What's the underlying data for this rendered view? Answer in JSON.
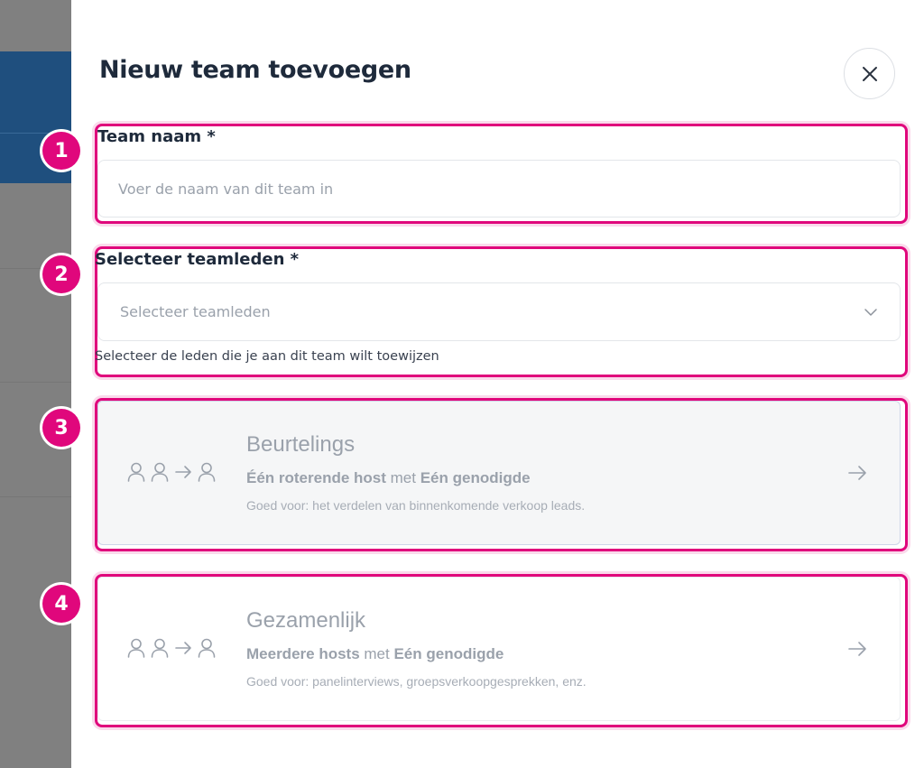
{
  "panel": {
    "title": "Nieuw team toevoegen"
  },
  "badges": [
    "1",
    "2",
    "3",
    "4"
  ],
  "team_name": {
    "label": "Team naam *",
    "placeholder": "Voer de naam van dit team in",
    "value": ""
  },
  "members": {
    "label": "Selecteer teamleden *",
    "placeholder": "Selecteer teamleden",
    "helper": "Selecteer de leden die je aan dit team wilt toewijzen"
  },
  "options": [
    {
      "title": "Beurtelings",
      "sub_bold_1": "Één roterende host",
      "sub_mid": " met ",
      "sub_bold_2": "Eén genodigde",
      "description": "Goed voor: het verdelen van binnenkomende verkoop leads."
    },
    {
      "title": "Gezamenlijk",
      "sub_bold_1": "Meerdere hosts",
      "sub_mid": " met ",
      "sub_bold_2": "Eén genodigde",
      "description": "Goed voor: panelinterviews, groepsverkoopgesprekken, enz."
    }
  ],
  "icons": {
    "close": "close-icon",
    "chevron": "chevron-down-icon",
    "user": "user-icon",
    "arrow": "arrow-right-icon"
  },
  "colors": {
    "highlight": "#e0077c",
    "title": "#1e2a3b",
    "muted": "#9aa1ab"
  }
}
